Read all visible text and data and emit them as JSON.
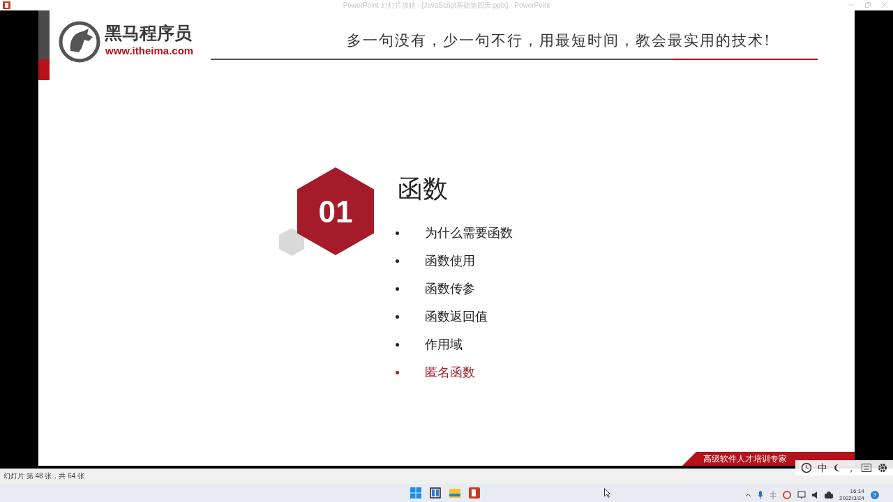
{
  "window": {
    "title": "PowerPoint 幻灯片放映 - [JavaScript基础第四天.pptx] - PowerPoint"
  },
  "slide": {
    "logo": {
      "name": "黑马程序员",
      "url": "www.itheima.com"
    },
    "tagline": "多一句没有，少一句不行，用最短时间，教会最实用的技术!",
    "section": {
      "number": "01",
      "title": "函数",
      "items": [
        {
          "text": "为什么需要函数",
          "highlighted": false
        },
        {
          "text": "函数使用",
          "highlighted": false
        },
        {
          "text": "函数传参",
          "highlighted": false
        },
        {
          "text": "函数返回值",
          "highlighted": false
        },
        {
          "text": "作用域",
          "highlighted": false
        },
        {
          "text": "匿名函数",
          "highlighted": true
        }
      ]
    },
    "banner": "高级软件人才培训专家"
  },
  "ime_toolbar": {
    "mode": "中",
    "punctuation": "，"
  },
  "status_bar": "幻灯片 第 48 张，共 64 张",
  "taskbar": {
    "time": "16:14",
    "date": "2022/3/24",
    "notification_count": "3"
  }
}
